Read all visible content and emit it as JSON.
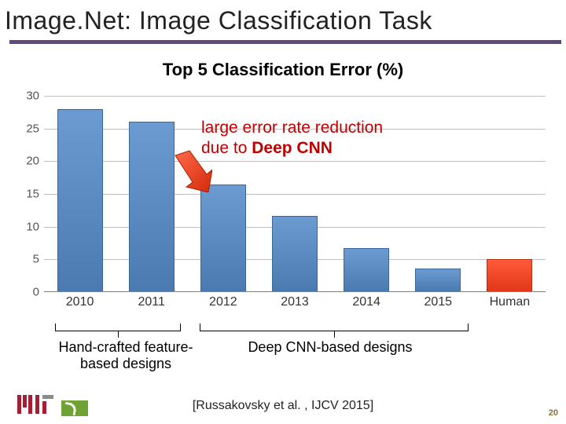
{
  "title": "Image.​Net: Image Classification Task",
  "chart_data": {
    "type": "bar",
    "title": "Top 5 Classification Error (%)",
    "categories": [
      "2010",
      "2011",
      "2012",
      "2013",
      "2014",
      "2015",
      "Human"
    ],
    "values": [
      28,
      26,
      16.4,
      11.7,
      6.7,
      3.6,
      5.1
    ],
    "highlight_index": 6,
    "ylim": [
      0,
      30
    ],
    "yticks": [
      0,
      5,
      10,
      15,
      20,
      25,
      30
    ],
    "xlabel": "",
    "ylabel": ""
  },
  "annotation": {
    "line1": "large error rate reduction",
    "line2_a": "due to ",
    "line2_b": "Deep CNN"
  },
  "brackets": {
    "left": "Hand-crafted feature-\nbased designs",
    "right": "Deep CNN-based designs"
  },
  "citation": "[Russakovsky et al. , IJCV 2015]",
  "page_number": "20",
  "colors": {
    "bar_blue": "#4a7ab0",
    "bar_red": "#e03818",
    "rule": "#604a7b",
    "anno": "#c00000"
  }
}
